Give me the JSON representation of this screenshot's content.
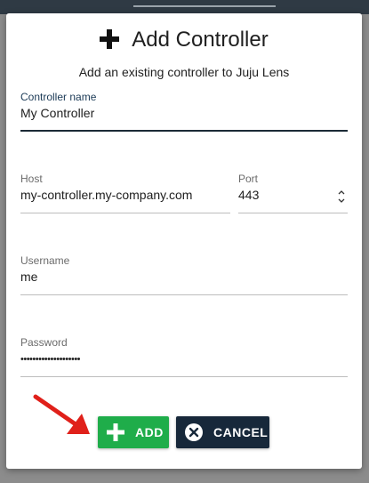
{
  "dialog": {
    "title": "Add Controller",
    "subtitle": "Add an existing controller to Juju Lens"
  },
  "form": {
    "controller_name": {
      "label": "Controller name",
      "value": "My Controller"
    },
    "host": {
      "label": "Host",
      "value": "my-controller.my-company.com"
    },
    "port": {
      "label": "Port",
      "value": "443"
    },
    "username": {
      "label": "Username",
      "value": "me"
    },
    "password": {
      "label": "Password",
      "value": "••••••••••••••••••••"
    }
  },
  "buttons": {
    "add_label": "ADD",
    "cancel_label": "CANCEL"
  },
  "colors": {
    "add": "#1fad4a",
    "cancel": "#17283a",
    "arrow": "#e0201a"
  },
  "icons": {
    "title": "plus-icon",
    "add": "plus-icon",
    "cancel": "close-circle-icon",
    "port_stepper": "stepper-icon",
    "pointer": "arrow-icon"
  }
}
